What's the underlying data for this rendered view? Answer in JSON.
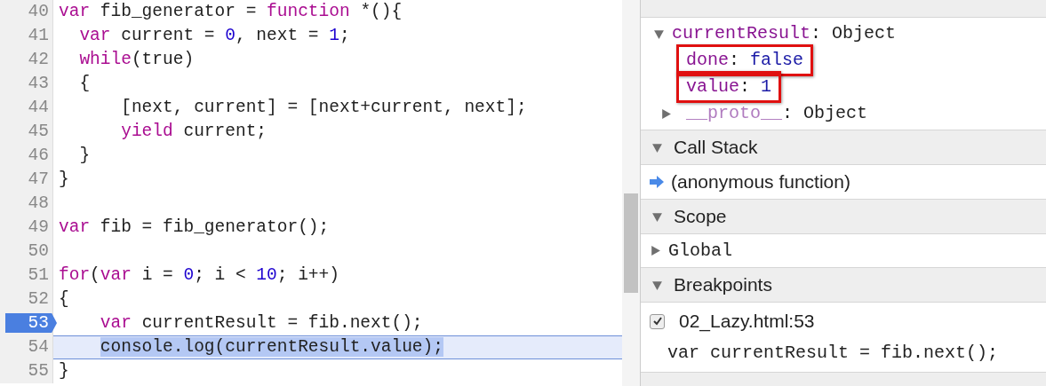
{
  "editor": {
    "lines": [
      {
        "number": "40",
        "breakpoint": false,
        "highlighted": false,
        "tokens": [
          {
            "kind": "keyword",
            "text": "var"
          },
          {
            "kind": "plain",
            "text": " fib_generator = "
          },
          {
            "kind": "keyword",
            "text": "function"
          },
          {
            "kind": "plain",
            "text": " *(){"
          }
        ]
      },
      {
        "number": "41",
        "breakpoint": false,
        "highlighted": false,
        "tokens": [
          {
            "kind": "keyword",
            "text": "  var"
          },
          {
            "kind": "plain",
            "text": " current = "
          },
          {
            "kind": "number",
            "text": "0"
          },
          {
            "kind": "plain",
            "text": ", next = "
          },
          {
            "kind": "number",
            "text": "1"
          },
          {
            "kind": "plain",
            "text": ";"
          }
        ]
      },
      {
        "number": "42",
        "breakpoint": false,
        "highlighted": false,
        "tokens": [
          {
            "kind": "keyword",
            "text": "  while"
          },
          {
            "kind": "plain",
            "text": "(true)"
          }
        ]
      },
      {
        "number": "43",
        "breakpoint": false,
        "highlighted": false,
        "tokens": [
          {
            "kind": "plain",
            "text": "  {"
          }
        ]
      },
      {
        "number": "44",
        "breakpoint": false,
        "highlighted": false,
        "tokens": [
          {
            "kind": "plain",
            "text": "      [next, current] = [next+current, next];"
          }
        ]
      },
      {
        "number": "45",
        "breakpoint": false,
        "highlighted": false,
        "tokens": [
          {
            "kind": "keyword",
            "text": "      yield"
          },
          {
            "kind": "plain",
            "text": " current;"
          }
        ]
      },
      {
        "number": "46",
        "breakpoint": false,
        "highlighted": false,
        "tokens": [
          {
            "kind": "plain",
            "text": "  }"
          }
        ]
      },
      {
        "number": "47",
        "breakpoint": false,
        "highlighted": false,
        "tokens": [
          {
            "kind": "plain",
            "text": "}"
          }
        ]
      },
      {
        "number": "48",
        "breakpoint": false,
        "highlighted": false
      },
      {
        "number": "49",
        "breakpoint": false,
        "highlighted": false,
        "tokens": [
          {
            "kind": "keyword",
            "text": "var"
          },
          {
            "kind": "plain",
            "text": " fib = fib_generator();"
          }
        ]
      },
      {
        "number": "50",
        "breakpoint": false,
        "highlighted": false
      },
      {
        "number": "51",
        "breakpoint": false,
        "highlighted": false,
        "tokens": [
          {
            "kind": "keyword",
            "text": "for"
          },
          {
            "kind": "plain",
            "text": "("
          },
          {
            "kind": "keyword",
            "text": "var"
          },
          {
            "kind": "plain",
            "text": " i = "
          },
          {
            "kind": "number",
            "text": "0"
          },
          {
            "kind": "plain",
            "text": "; i < "
          },
          {
            "kind": "number",
            "text": "10"
          },
          {
            "kind": "plain",
            "text": "; i++)"
          }
        ]
      },
      {
        "number": "52",
        "breakpoint": false,
        "highlighted": false,
        "tokens": [
          {
            "kind": "plain",
            "text": "{"
          }
        ]
      },
      {
        "number": "53",
        "breakpoint": true,
        "highlighted": false,
        "tokens": [
          {
            "kind": "keyword",
            "text": "    var"
          },
          {
            "kind": "plain",
            "text": " currentResult = fib.next();"
          }
        ]
      },
      {
        "number": "54",
        "breakpoint": false,
        "highlighted": true,
        "tokens": [
          {
            "kind": "plain",
            "text": "    console.log(currentResult.value);"
          }
        ]
      },
      {
        "number": "55",
        "breakpoint": false,
        "highlighted": false,
        "tokens": [
          {
            "kind": "plain",
            "text": "}"
          }
        ]
      }
    ]
  },
  "sidebar": {
    "watch": {
      "items": [
        {
          "key": "currentResult",
          "separator": ":",
          "value": "Object",
          "expanded": true,
          "children": [
            {
              "key": "done",
              "separator": ":",
              "value": "false",
              "kind": "primitive",
              "annotated": true
            },
            {
              "key": "value",
              "separator": ":",
              "value": "1",
              "kind": "primitive",
              "annotated": true
            },
            {
              "key": "__proto__",
              "separator": ":",
              "value": "Object",
              "kind": "object",
              "annotated": false,
              "expanded": false
            }
          ]
        }
      ]
    },
    "call_stack": {
      "title": "Call Stack",
      "expanded": true,
      "frames": [
        {
          "label": "(anonymous function)",
          "selected": true
        }
      ]
    },
    "scope": {
      "title": "Scope",
      "expanded": true,
      "items": [
        {
          "label": "Global",
          "expanded": false
        }
      ]
    },
    "breakpoints": {
      "title": "Breakpoints",
      "expanded": true,
      "items": [
        {
          "file": "02_Lazy.html:53",
          "checked": true,
          "code": "var currentResult = fib.next();"
        }
      ]
    }
  }
}
